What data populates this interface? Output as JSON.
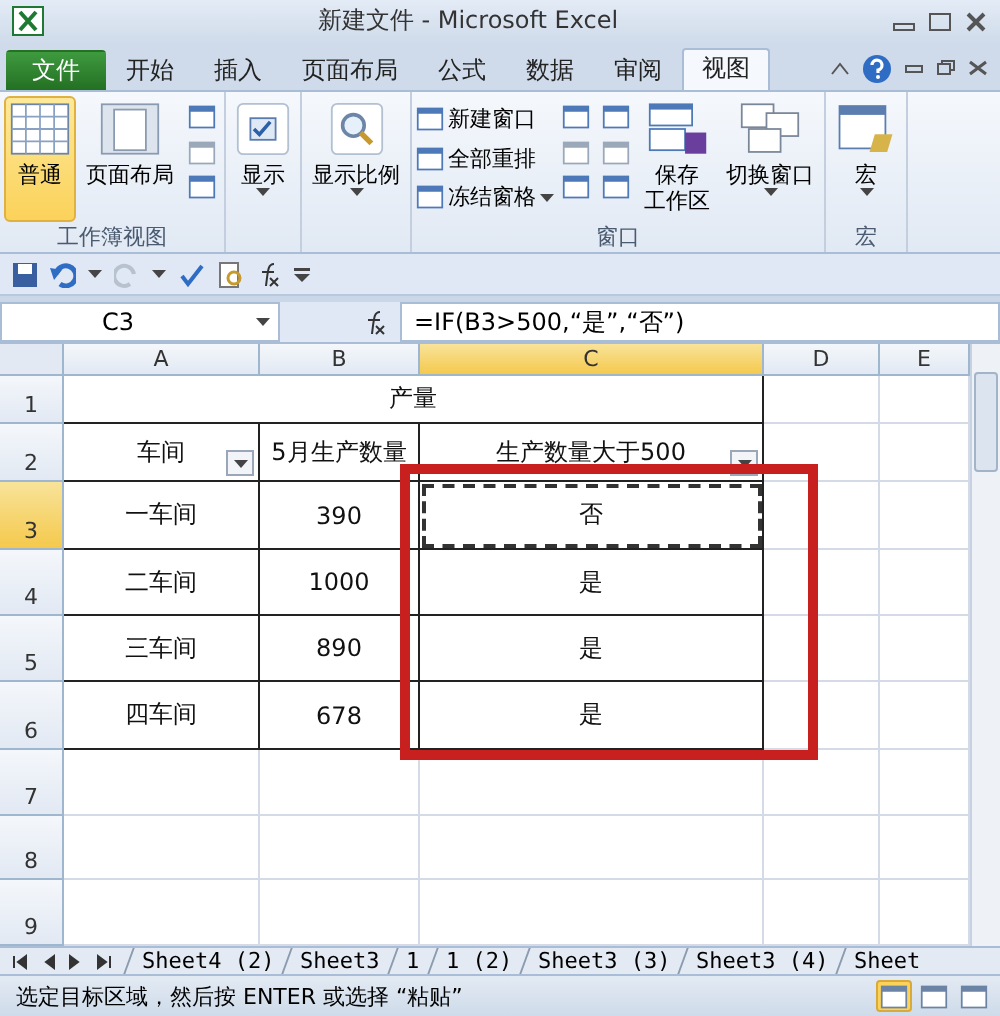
{
  "window": {
    "title": "新建文件 - Microsoft Excel"
  },
  "ribbon_tabs": [
    {
      "label": "文件",
      "kind": "file",
      "selected": false
    },
    {
      "label": "开始",
      "kind": "tab",
      "selected": false
    },
    {
      "label": "插入",
      "kind": "tab",
      "selected": false
    },
    {
      "label": "页面布局",
      "kind": "tab",
      "selected": false
    },
    {
      "label": "公式",
      "kind": "tab",
      "selected": false
    },
    {
      "label": "数据",
      "kind": "tab",
      "selected": false
    },
    {
      "label": "审阅",
      "kind": "tab",
      "selected": false
    },
    {
      "label": "视图",
      "kind": "tab",
      "selected": true
    }
  ],
  "ribbon_groups": [
    {
      "label": "工作簿视图",
      "buttons": [
        {
          "kind": "large",
          "label": [
            "普通"
          ],
          "selected": true,
          "dropdown": false
        },
        {
          "kind": "large",
          "label": [
            "页面布局"
          ],
          "selected": false,
          "dropdown": false
        },
        {
          "kind": "iconcol"
        }
      ]
    },
    {
      "buttons": [
        {
          "kind": "large",
          "label": [
            "显示"
          ],
          "dropdown": true,
          "selected": false
        }
      ]
    },
    {
      "buttons": [
        {
          "kind": "large",
          "label": [
            "显示比例"
          ],
          "dropdown": true,
          "selected": false
        }
      ]
    },
    {
      "label": "窗口",
      "buttons": [
        {
          "kind": "smallcol",
          "items": [
            {
              "label": "新建窗口",
              "dropdown": false
            },
            {
              "label": "全部重排",
              "dropdown": false
            },
            {
              "label": "冻结窗格",
              "dropdown": true
            }
          ]
        },
        {
          "kind": "iconcol"
        },
        {
          "kind": "iconcol"
        },
        {
          "kind": "large",
          "label": [
            "保存",
            "工作区"
          ],
          "selected": false,
          "dropdown": false
        },
        {
          "kind": "large",
          "label": [
            "切换窗口"
          ],
          "dropdown": true,
          "selected": false
        }
      ]
    },
    {
      "label": "宏",
      "buttons": [
        {
          "kind": "large",
          "label": [
            "宏"
          ],
          "dropdown": true,
          "selected": false
        }
      ]
    }
  ],
  "name_box": "C3",
  "formula": "=IF(B3>500,“是”,“否”)",
  "columns": [
    {
      "label": "A",
      "selected": false
    },
    {
      "label": "B",
      "selected": false
    },
    {
      "label": "C",
      "selected": true
    },
    {
      "label": "D",
      "selected": false
    },
    {
      "label": "E",
      "selected": false
    }
  ],
  "rows": [
    {
      "number": "1",
      "selected": false,
      "kind": "title",
      "title": "产量"
    },
    {
      "number": "2",
      "selected": false,
      "kind": "data",
      "cells": [
        {
          "text": "车间",
          "filter": true,
          "active": false
        },
        {
          "text": "5月生产数量",
          "filter": false,
          "active": false
        },
        {
          "text": "生产数量大于500",
          "filter": true,
          "active": false
        }
      ]
    },
    {
      "number": "3",
      "selected": true,
      "kind": "data",
      "cells": [
        {
          "text": "一车间",
          "active": false
        },
        {
          "text": "390",
          "active": false
        },
        {
          "text": "否",
          "active": true
        }
      ]
    },
    {
      "number": "4",
      "selected": false,
      "kind": "data",
      "cells": [
        {
          "text": "二车间",
          "active": false
        },
        {
          "text": "1000",
          "active": false
        },
        {
          "text": "是",
          "active": false
        }
      ]
    },
    {
      "number": "5",
      "selected": false,
      "kind": "data",
      "cells": [
        {
          "text": "三车间",
          "active": false
        },
        {
          "text": "890",
          "active": false
        },
        {
          "text": "是",
          "active": false
        }
      ]
    },
    {
      "number": "6",
      "selected": false,
      "kind": "data",
      "cells": [
        {
          "text": "四车间",
          "active": false
        },
        {
          "text": "678",
          "active": false
        },
        {
          "text": "是",
          "active": false
        }
      ]
    },
    {
      "number": "7",
      "selected": false,
      "kind": "empty"
    },
    {
      "number": "8",
      "selected": false,
      "kind": "empty"
    },
    {
      "number": "9",
      "selected": false,
      "kind": "empty"
    }
  ],
  "sheet_tabs": [
    "Sheet4 (2)",
    "Sheet3",
    "1",
    "1 (2)",
    "Sheet3 (3)",
    "Sheet3 (4)",
    "Sheet"
  ],
  "status_bar": {
    "text": "选定目标区域，然后按 ENTER 或选择 “粘贴”",
    "views": [
      {
        "selected": true
      },
      {
        "selected": false
      },
      {
        "selected": false
      }
    ]
  }
}
